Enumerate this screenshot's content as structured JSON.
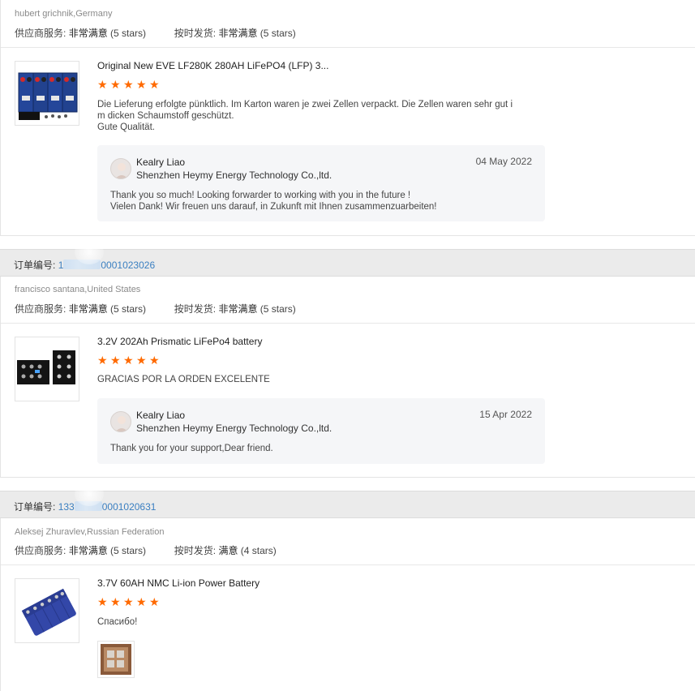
{
  "labels": {
    "supplier_service": "供应商服务:",
    "on_time_shipping": "按时发货:",
    "order_number": "订单编号:"
  },
  "colors": {
    "star": "#ff6a00",
    "order_link": "#3a7fc1",
    "header_bg": "#ebebeb"
  },
  "reviews": [
    {
      "buyer": "hubert grichnik,Germany",
      "supplier_service": "非常满意",
      "supplier_stars": "(5 stars)",
      "shipping": "非常满意",
      "shipping_stars": "(5 stars)",
      "product_title": "Original New EVE LF280K 280AH LiFePO4 (LFP) 3...",
      "rating": 5,
      "review_lines": [
        "Die Lieferung erfolgte pünktlich. Im Karton waren je zwei Zellen verpackt. Die Zellen waren sehr gut i",
        "m dicken Schaumstoff geschützt.",
        "Gute Qualität."
      ],
      "reply": {
        "name": "Kealry Liao",
        "company": "Shenzhen Heymy Energy Technology Co.,ltd.",
        "date": "04 May 2022",
        "lines": [
          "Thank you so much! Looking forwarder to working with you in the future !",
          "Vielen Dank!   Wir freuen uns darauf, in Zukunft mit Ihnen zusammenzuarbeiten!"
        ]
      }
    },
    {
      "order_prefix": "1",
      "order_suffix": "0001023026",
      "buyer": "francisco santana,United States",
      "supplier_service": "非常满意",
      "supplier_stars": "(5 stars)",
      "shipping": "非常满意",
      "shipping_stars": "(5 stars)",
      "product_title": "3.2V 202Ah Prismatic LiFePo4 battery",
      "rating": 5,
      "review_lines": [
        "GRACIAS POR LA ORDEN EXCELENTE"
      ],
      "reply": {
        "name": "Kealry Liao",
        "company": "Shenzhen Heymy Energy Technology Co.,ltd.",
        "date": "15 Apr 2022",
        "lines": [
          "Thank you for your support,Dear friend."
        ]
      }
    },
    {
      "order_prefix": "133",
      "order_suffix": "0001020631",
      "buyer": "Aleksej Zhuravlev,Russian Federation",
      "supplier_service": "非常满意",
      "supplier_stars": "(5 stars)",
      "shipping": "满意",
      "shipping_stars": "(4 stars)",
      "product_title": "3.7V 60AH NMC Li-ion Power Battery",
      "rating": 5,
      "review_lines": [
        "Спасибо!"
      ]
    }
  ]
}
